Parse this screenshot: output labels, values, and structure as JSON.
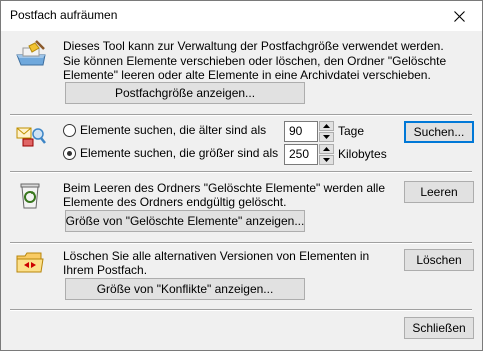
{
  "window": {
    "title": "Postfach aufräumen"
  },
  "section1": {
    "description_line1": "Dieses Tool kann zur Verwaltung der Postfachgröße verwendet werden.",
    "description_line2": "Sie können Elemente verschieben oder löschen, den Ordner \"Gelöschte",
    "description_line3": "Elemente\" leeren oder alte Elemente in eine Archivdatei verschieben.",
    "show_size_button": "Postfachgröße anzeigen..."
  },
  "section2": {
    "option_older_label": "Elemente suchen, die älter sind als",
    "option_older_value": "90",
    "option_older_unit": "Tage",
    "option_larger_label": "Elemente suchen, die größer sind als",
    "option_larger_value": "250",
    "option_larger_unit": "Kilobytes",
    "selected_option": "larger",
    "search_button": "Suchen..."
  },
  "section3": {
    "description_line1": "Beim Leeren des Ordners \"Gelöschte Elemente\" werden alle",
    "description_line2": "Elemente des Ordners endgültig gelöscht.",
    "show_size_button": "Größe von \"Gelöschte Elemente\" anzeigen...",
    "empty_button": "Leeren"
  },
  "section4": {
    "description_line1": "Löschen Sie alle alternativen Versionen von Elementen in",
    "description_line2": "Ihrem Postfach.",
    "show_size_button": "Größe von \"Konflikte\" anzeigen...",
    "delete_button": "Löschen"
  },
  "footer": {
    "close_button": "Schließen"
  }
}
